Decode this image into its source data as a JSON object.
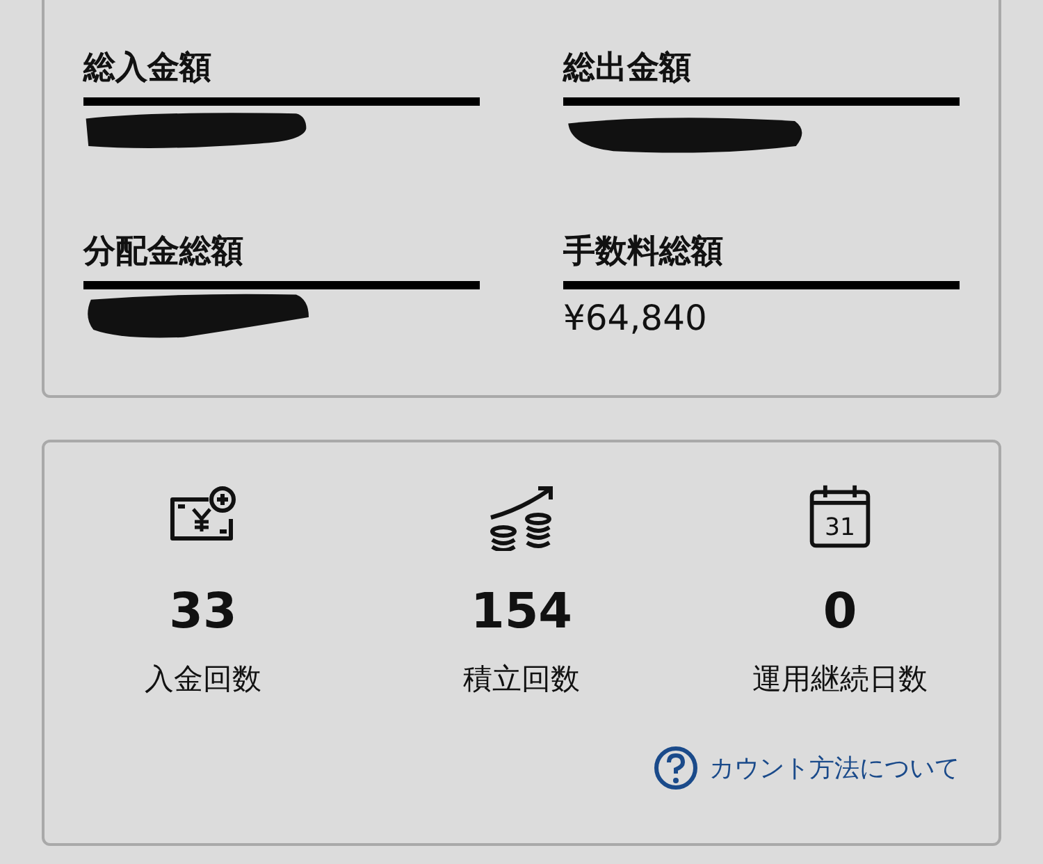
{
  "summary": [
    {
      "label": "総入金額",
      "redacted": true
    },
    {
      "label": "総出金額",
      "redacted": true
    },
    {
      "label": "分配金総額",
      "redacted": true
    },
    {
      "label": "手数料総額",
      "redacted": false,
      "value": "¥64,840"
    }
  ],
  "stats": [
    {
      "kind": "deposit",
      "value": "33",
      "label": "入金回数"
    },
    {
      "kind": "growth",
      "value": "154",
      "label": "積立回数"
    },
    {
      "kind": "calendar",
      "icon_text": "31",
      "value": "0",
      "label": "運用継続日数"
    }
  ],
  "help_link": {
    "label": "カウント方法について"
  }
}
